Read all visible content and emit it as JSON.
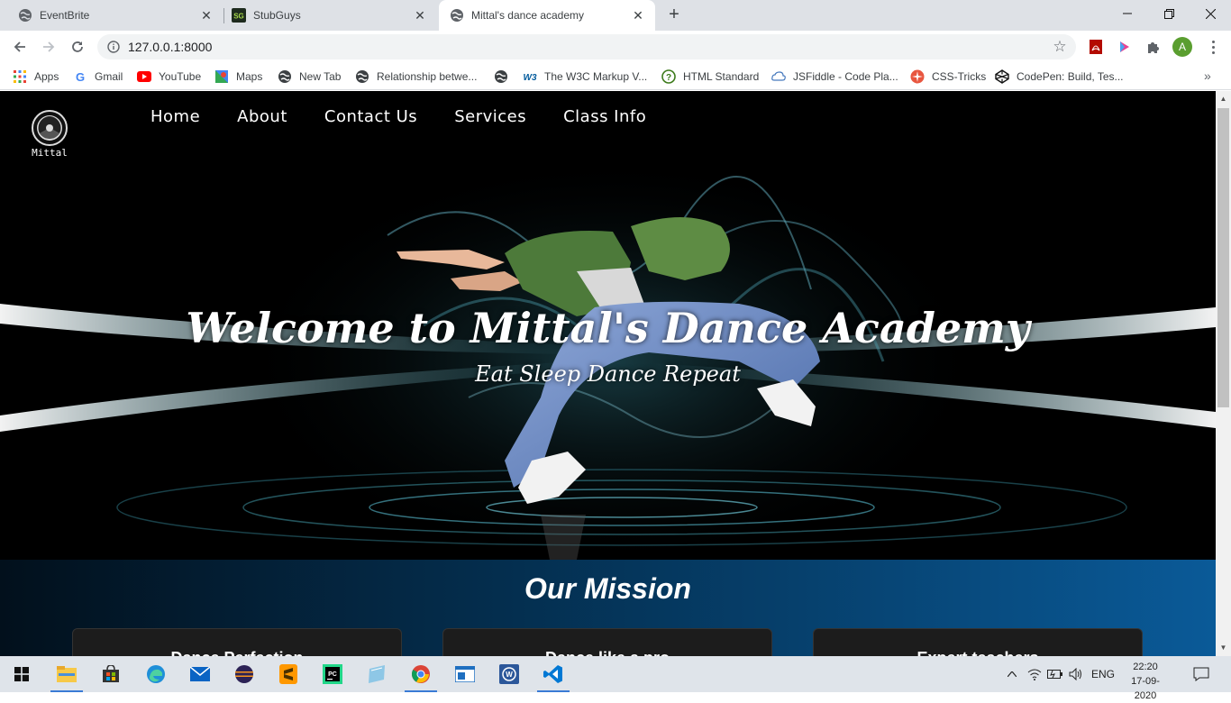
{
  "browser": {
    "tabs": [
      {
        "title": "EventBrite",
        "active": false,
        "icon": "globe-icon"
      },
      {
        "title": "StubGuys",
        "active": false,
        "icon": "stubguys-icon"
      },
      {
        "title": "Mittal's dance academy",
        "active": true,
        "icon": "globe-icon"
      }
    ],
    "url": "127.0.0.1:8000",
    "profile_initial": "A",
    "bookmarks": [
      {
        "label": "Apps",
        "icon": "apps-grid-icon"
      },
      {
        "label": "Gmail",
        "icon": "google-icon"
      },
      {
        "label": "YouTube",
        "icon": "youtube-icon"
      },
      {
        "label": "Maps",
        "icon": "maps-icon"
      },
      {
        "label": "New Tab",
        "icon": "globe-icon"
      },
      {
        "label": "Relationship betwe...",
        "icon": "globe-icon"
      },
      {
        "label": "",
        "icon": "globe-icon"
      },
      {
        "label": "The W3C Markup V...",
        "icon": "w3c-icon"
      },
      {
        "label": "HTML Standard",
        "icon": "whatwg-icon"
      },
      {
        "label": "JSFiddle - Code Pla...",
        "icon": "jsfiddle-icon"
      },
      {
        "label": "CSS-Tricks",
        "icon": "csstricks-icon"
      },
      {
        "label": "CodePen: Build, Tes...",
        "icon": "codepen-icon"
      }
    ]
  },
  "site": {
    "logo_text": "Mittal",
    "nav": [
      "Home",
      "About",
      "Contact Us",
      "Services",
      "Class Info"
    ],
    "hero_title": "Welcome to Mittal's Dance Academy",
    "hero_subtitle": "Eat Sleep Dance Repeat",
    "mission_title": "Our Mission",
    "cards": [
      "Dance Perfection",
      "Dance like a pro",
      "Expert teachers"
    ]
  },
  "taskbar": {
    "language": "ENG",
    "time": "22:20",
    "date": "17-09-2020"
  },
  "colors": {
    "tabstrip": "#dee1e6",
    "mission_dark": "#02101c",
    "mission_light": "#0a5a98",
    "profile": "#5a9e2f"
  }
}
